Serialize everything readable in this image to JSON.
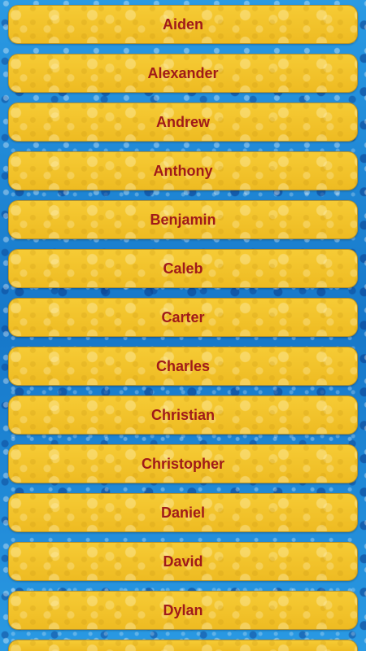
{
  "colors": {
    "background": "#1f8fd9",
    "button_fill": "#f2c128",
    "button_border": "#b8932a",
    "label_text": "#a01a1a"
  },
  "names": {
    "items": [
      {
        "label": "Aiden"
      },
      {
        "label": "Alexander"
      },
      {
        "label": "Andrew"
      },
      {
        "label": "Anthony"
      },
      {
        "label": "Benjamin"
      },
      {
        "label": "Caleb"
      },
      {
        "label": "Carter"
      },
      {
        "label": "Charles"
      },
      {
        "label": "Christian"
      },
      {
        "label": "Christopher"
      },
      {
        "label": "Daniel"
      },
      {
        "label": "David"
      },
      {
        "label": "Dylan"
      },
      {
        "label": ""
      }
    ]
  }
}
